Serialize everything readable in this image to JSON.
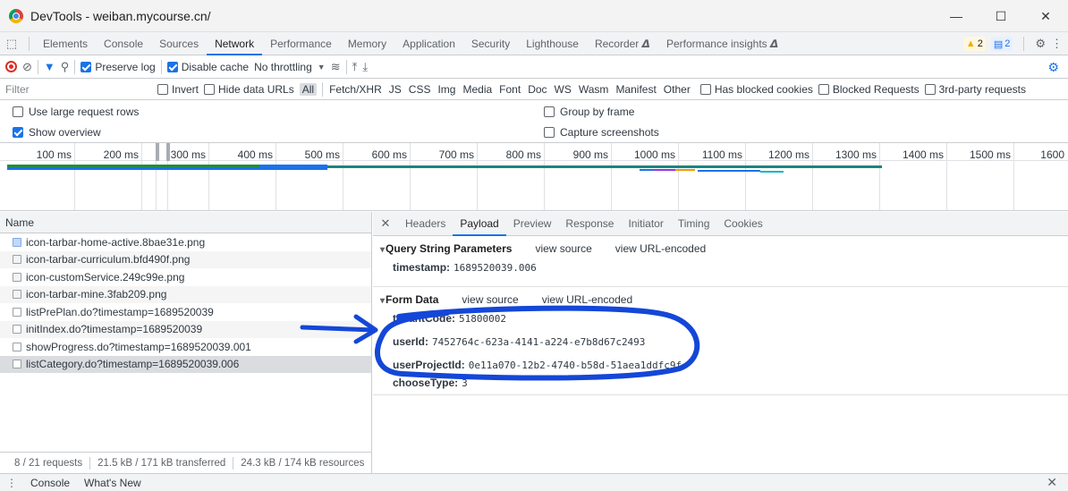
{
  "window": {
    "title": "DevTools - weiban.mycourse.cn/",
    "controls": [
      "—",
      "☐",
      "✕"
    ]
  },
  "tabs": [
    "Elements",
    "Console",
    "Sources",
    "Network",
    "Performance",
    "Memory",
    "Application",
    "Security",
    "Lighthouse",
    "Recorder 𝞓",
    "Performance insights 𝞓"
  ],
  "active_tab": "Network",
  "badges": {
    "warnings": "2",
    "messages": "2"
  },
  "toolbar": {
    "preserve_log": "Preserve log",
    "disable_cache": "Disable cache",
    "throttling": "No throttling"
  },
  "filter": {
    "placeholder": "Filter",
    "invert": "Invert",
    "hide_data_urls": "Hide data URLs",
    "types": [
      "All",
      "Fetch/XHR",
      "JS",
      "CSS",
      "Img",
      "Media",
      "Font",
      "Doc",
      "WS",
      "Wasm",
      "Manifest",
      "Other"
    ],
    "has_blocked_cookies": "Has blocked cookies",
    "blocked_requests": "Blocked Requests",
    "third_party": "3rd-party requests"
  },
  "options": {
    "large_rows": "Use large request rows",
    "group_by_frame": "Group by frame",
    "show_overview": "Show overview",
    "capture_screenshots": "Capture screenshots"
  },
  "timeline": {
    "ticks": [
      "100 ms",
      "200 ms",
      "300 ms",
      "400 ms",
      "500 ms",
      "600 ms",
      "700 ms",
      "800 ms",
      "900 ms",
      "1000 ms",
      "1100 ms",
      "1200 ms",
      "1300 ms",
      "1400 ms",
      "1500 ms",
      "1600"
    ]
  },
  "requests": {
    "header": "Name",
    "items": [
      "icon-tarbar-home-active.8bae31e.png",
      "icon-tarbar-curriculum.bfd490f.png",
      "icon-customService.249c99e.png",
      "icon-tarbar-mine.3fab209.png",
      "listPrePlan.do?timestamp=1689520039",
      "initIndex.do?timestamp=1689520039",
      "showProgress.do?timestamp=1689520039.001",
      "listCategory.do?timestamp=1689520039.006"
    ],
    "status": {
      "requests": "8 / 21 requests",
      "transferred": "21.5 kB / 171 kB transferred",
      "resources": "24.3 kB / 174 kB resources"
    }
  },
  "detail": {
    "tabs": [
      "Headers",
      "Payload",
      "Preview",
      "Response",
      "Initiator",
      "Timing",
      "Cookies"
    ],
    "active": "Payload",
    "query": {
      "title": "Query String Parameters",
      "view_source": "view source",
      "view_encoded": "view URL-encoded",
      "timestamp_key": "timestamp:",
      "timestamp_val": "1689520039.006"
    },
    "form": {
      "title": "Form Data",
      "view_source": "view source",
      "view_encoded": "view URL-encoded",
      "tenant_key": "tenantCode:",
      "tenant_val": "51800002",
      "user_key": "userId:",
      "user_val": "7452764c-623a-4141-a224-e7b8d67c2493",
      "project_key": "userProjectId:",
      "project_val": "0e11a070-12b2-4740-b58d-51aea1ddfc9f",
      "choose_key": "chooseType:",
      "choose_val": "3"
    }
  },
  "drawer": {
    "tabs": [
      "Console",
      "What's New"
    ]
  },
  "colors": {
    "accent": "#1a73e8",
    "annotation": "#1447d8"
  }
}
